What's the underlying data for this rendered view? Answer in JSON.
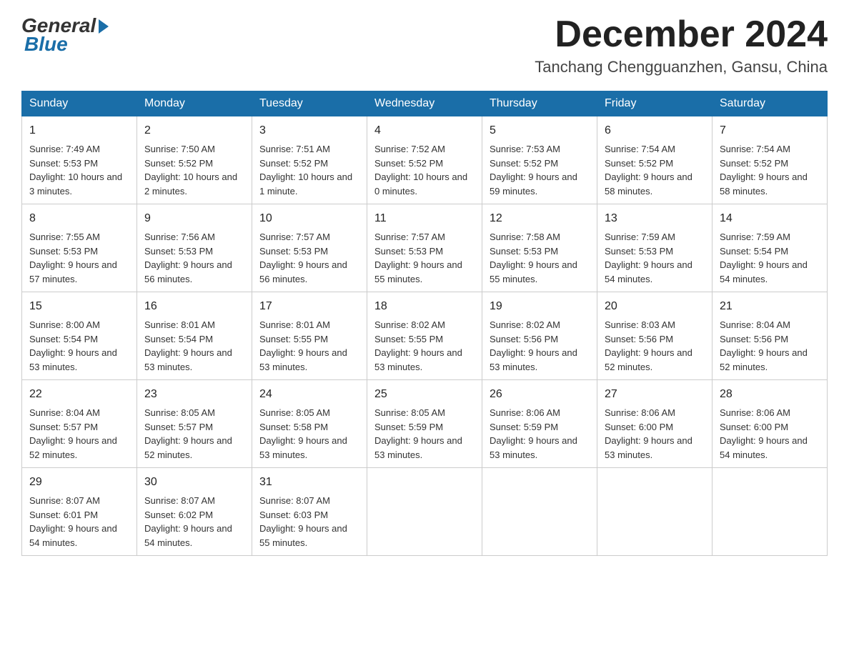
{
  "logo": {
    "general": "General",
    "blue": "Blue"
  },
  "title": "December 2024",
  "location": "Tanchang Chengguanzhen, Gansu, China",
  "days_header": [
    "Sunday",
    "Monday",
    "Tuesday",
    "Wednesday",
    "Thursday",
    "Friday",
    "Saturday"
  ],
  "weeks": [
    [
      {
        "day": "1",
        "sunrise": "7:49 AM",
        "sunset": "5:53 PM",
        "daylight": "10 hours and 3 minutes."
      },
      {
        "day": "2",
        "sunrise": "7:50 AM",
        "sunset": "5:52 PM",
        "daylight": "10 hours and 2 minutes."
      },
      {
        "day": "3",
        "sunrise": "7:51 AM",
        "sunset": "5:52 PM",
        "daylight": "10 hours and 1 minute."
      },
      {
        "day": "4",
        "sunrise": "7:52 AM",
        "sunset": "5:52 PM",
        "daylight": "10 hours and 0 minutes."
      },
      {
        "day": "5",
        "sunrise": "7:53 AM",
        "sunset": "5:52 PM",
        "daylight": "9 hours and 59 minutes."
      },
      {
        "day": "6",
        "sunrise": "7:54 AM",
        "sunset": "5:52 PM",
        "daylight": "9 hours and 58 minutes."
      },
      {
        "day": "7",
        "sunrise": "7:54 AM",
        "sunset": "5:52 PM",
        "daylight": "9 hours and 58 minutes."
      }
    ],
    [
      {
        "day": "8",
        "sunrise": "7:55 AM",
        "sunset": "5:53 PM",
        "daylight": "9 hours and 57 minutes."
      },
      {
        "day": "9",
        "sunrise": "7:56 AM",
        "sunset": "5:53 PM",
        "daylight": "9 hours and 56 minutes."
      },
      {
        "day": "10",
        "sunrise": "7:57 AM",
        "sunset": "5:53 PM",
        "daylight": "9 hours and 56 minutes."
      },
      {
        "day": "11",
        "sunrise": "7:57 AM",
        "sunset": "5:53 PM",
        "daylight": "9 hours and 55 minutes."
      },
      {
        "day": "12",
        "sunrise": "7:58 AM",
        "sunset": "5:53 PM",
        "daylight": "9 hours and 55 minutes."
      },
      {
        "day": "13",
        "sunrise": "7:59 AM",
        "sunset": "5:53 PM",
        "daylight": "9 hours and 54 minutes."
      },
      {
        "day": "14",
        "sunrise": "7:59 AM",
        "sunset": "5:54 PM",
        "daylight": "9 hours and 54 minutes."
      }
    ],
    [
      {
        "day": "15",
        "sunrise": "8:00 AM",
        "sunset": "5:54 PM",
        "daylight": "9 hours and 53 minutes."
      },
      {
        "day": "16",
        "sunrise": "8:01 AM",
        "sunset": "5:54 PM",
        "daylight": "9 hours and 53 minutes."
      },
      {
        "day": "17",
        "sunrise": "8:01 AM",
        "sunset": "5:55 PM",
        "daylight": "9 hours and 53 minutes."
      },
      {
        "day": "18",
        "sunrise": "8:02 AM",
        "sunset": "5:55 PM",
        "daylight": "9 hours and 53 minutes."
      },
      {
        "day": "19",
        "sunrise": "8:02 AM",
        "sunset": "5:56 PM",
        "daylight": "9 hours and 53 minutes."
      },
      {
        "day": "20",
        "sunrise": "8:03 AM",
        "sunset": "5:56 PM",
        "daylight": "9 hours and 52 minutes."
      },
      {
        "day": "21",
        "sunrise": "8:04 AM",
        "sunset": "5:56 PM",
        "daylight": "9 hours and 52 minutes."
      }
    ],
    [
      {
        "day": "22",
        "sunrise": "8:04 AM",
        "sunset": "5:57 PM",
        "daylight": "9 hours and 52 minutes."
      },
      {
        "day": "23",
        "sunrise": "8:05 AM",
        "sunset": "5:57 PM",
        "daylight": "9 hours and 52 minutes."
      },
      {
        "day": "24",
        "sunrise": "8:05 AM",
        "sunset": "5:58 PM",
        "daylight": "9 hours and 53 minutes."
      },
      {
        "day": "25",
        "sunrise": "8:05 AM",
        "sunset": "5:59 PM",
        "daylight": "9 hours and 53 minutes."
      },
      {
        "day": "26",
        "sunrise": "8:06 AM",
        "sunset": "5:59 PM",
        "daylight": "9 hours and 53 minutes."
      },
      {
        "day": "27",
        "sunrise": "8:06 AM",
        "sunset": "6:00 PM",
        "daylight": "9 hours and 53 minutes."
      },
      {
        "day": "28",
        "sunrise": "8:06 AM",
        "sunset": "6:00 PM",
        "daylight": "9 hours and 54 minutes."
      }
    ],
    [
      {
        "day": "29",
        "sunrise": "8:07 AM",
        "sunset": "6:01 PM",
        "daylight": "9 hours and 54 minutes."
      },
      {
        "day": "30",
        "sunrise": "8:07 AM",
        "sunset": "6:02 PM",
        "daylight": "9 hours and 54 minutes."
      },
      {
        "day": "31",
        "sunrise": "8:07 AM",
        "sunset": "6:03 PM",
        "daylight": "9 hours and 55 minutes."
      },
      null,
      null,
      null,
      null
    ]
  ]
}
